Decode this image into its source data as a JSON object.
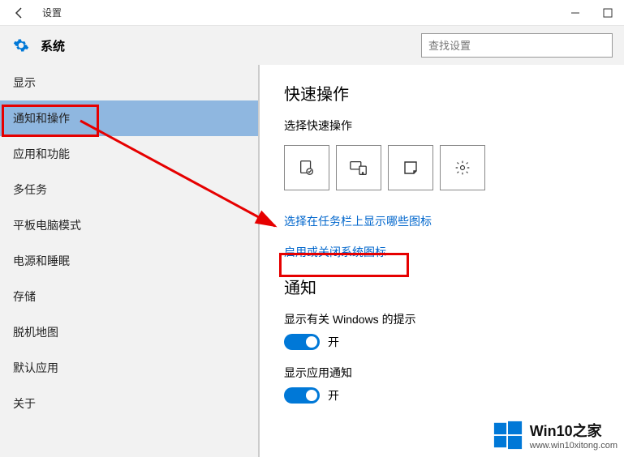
{
  "titlebar": {
    "title": "设置"
  },
  "header": {
    "title": "系统",
    "search_placeholder": "查找设置"
  },
  "sidebar": {
    "items": [
      {
        "label": "显示"
      },
      {
        "label": "通知和操作"
      },
      {
        "label": "应用和功能"
      },
      {
        "label": "多任务"
      },
      {
        "label": "平板电脑模式"
      },
      {
        "label": "电源和睡眠"
      },
      {
        "label": "存储"
      },
      {
        "label": "脱机地图"
      },
      {
        "label": "默认应用"
      },
      {
        "label": "关于"
      }
    ]
  },
  "main": {
    "quick_title": "快速操作",
    "quick_subtitle": "选择快速操作",
    "link1": "选择在任务栏上显示哪些图标",
    "link2": "启用或关闭系统图标",
    "notify_title": "通知",
    "toggle1_label": "显示有关 Windows 的提示",
    "toggle1_state": "开",
    "toggle2_label": "显示应用通知",
    "toggle2_state": "开"
  },
  "watermark": {
    "title": "Win10之家",
    "url": "www.win10xitong.com"
  }
}
